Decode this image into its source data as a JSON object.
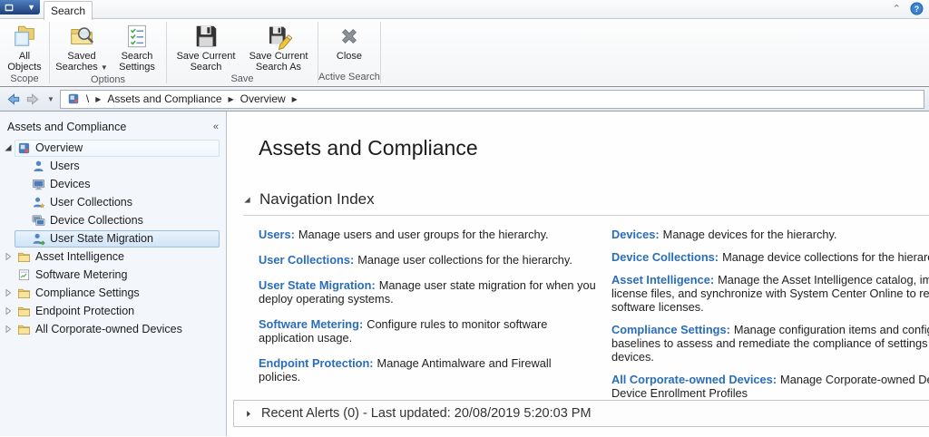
{
  "ribbon": {
    "tab": "Search",
    "groups": [
      {
        "label": "Scope",
        "buttons": [
          {
            "label": "All Objects",
            "icon": "all-objects-icon"
          }
        ]
      },
      {
        "label": "Options",
        "buttons": [
          {
            "label": "Saved Searches",
            "icon": "saved-searches-icon",
            "has_dropdown": true
          },
          {
            "label": "Search Settings",
            "icon": "search-settings-icon"
          }
        ]
      },
      {
        "label": "Save",
        "buttons": [
          {
            "label": "Save Current Search",
            "icon": "save-icon"
          },
          {
            "label": "Save Current Search As",
            "icon": "save-as-icon"
          }
        ]
      },
      {
        "label": "Active Search",
        "buttons": [
          {
            "label": "Close",
            "icon": "close-icon"
          }
        ]
      }
    ]
  },
  "breadcrumb": {
    "root": "\\",
    "items": [
      "Assets and Compliance",
      "Overview"
    ]
  },
  "sidebar": {
    "header": "Assets and Compliance",
    "collapse_glyph": "«",
    "items": [
      {
        "label": "Overview",
        "icon": "overview-icon",
        "expanded": true,
        "highlight": "soft"
      },
      {
        "label": "Users",
        "icon": "user-icon"
      },
      {
        "label": "Devices",
        "icon": "device-icon"
      },
      {
        "label": "User Collections",
        "icon": "user-collections-icon"
      },
      {
        "label": "Device Collections",
        "icon": "device-collections-icon"
      },
      {
        "label": "User State Migration",
        "icon": "user-state-migration-icon",
        "highlight": "strong",
        "selected": true
      },
      {
        "label": "Asset Intelligence",
        "icon": "folder-icon",
        "collapsed": true
      },
      {
        "label": "Software Metering",
        "icon": "software-metering-icon"
      },
      {
        "label": "Compliance Settings",
        "icon": "folder-icon",
        "collapsed": true
      },
      {
        "label": "Endpoint Protection",
        "icon": "folder-icon",
        "collapsed": true
      },
      {
        "label": "All Corporate-owned Devices",
        "icon": "folder-icon",
        "collapsed": true
      }
    ]
  },
  "main": {
    "title": "Assets and Compliance",
    "section_title": "Navigation Index",
    "nav_left": [
      {
        "name": "Users",
        "description": "Manage users and user groups for the hierarchy."
      },
      {
        "name": "User Collections",
        "description": "Manage user collections for the hierarchy."
      },
      {
        "name": "User State Migration",
        "description": "Manage user state migration for when you deploy operating systems."
      },
      {
        "name": "Software Metering",
        "description": "Configure rules to monitor software application usage."
      },
      {
        "name": "Endpoint Protection",
        "description": "Manage Antimalware and Firewall policies."
      }
    ],
    "nav_right": [
      {
        "name": "Devices",
        "description": "Manage devices for the hierarchy."
      },
      {
        "name": "Device Collections",
        "description": "Manage device collections for the hierarchy."
      },
      {
        "name": "Asset Intelligence",
        "description": "Manage the Asset Intelligence catalog, import license files, and synchronize with System Center Online to reconcile software licenses."
      },
      {
        "name": "Compliance Settings",
        "description": "Manage configuration items and configuration baselines to assess and remediate the compliance of settings on devices."
      },
      {
        "name": "All Corporate-owned Devices",
        "description": "Manage Corporate-owned Devices and Device Enrollment Profiles"
      }
    ],
    "alerts_text": "Recent Alerts (0) - Last updated: 20/08/2019 5:20:03 PM"
  },
  "colors": {
    "link_blue": "#2a6db8",
    "selection_border": "#9ebfe0",
    "selection_fill": "#d0e4f7",
    "folder_yellow": "#efce6e",
    "app_button_blue": "#1d3f77"
  }
}
